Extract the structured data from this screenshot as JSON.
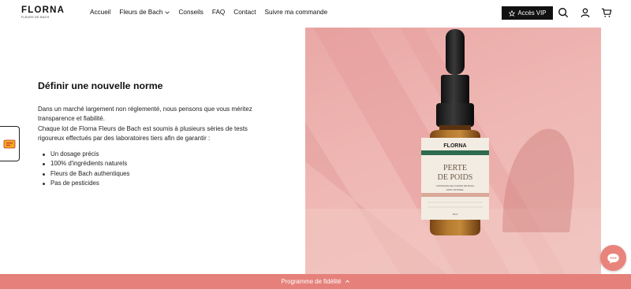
{
  "header": {
    "logo": {
      "name": "FLORNA",
      "tagline": "FLEURS DE BACH"
    },
    "nav": [
      {
        "label": "Accueil"
      },
      {
        "label": "Fleurs de Bach",
        "has_dropdown": true
      },
      {
        "label": "Conseils"
      },
      {
        "label": "FAQ"
      },
      {
        "label": "Contact"
      },
      {
        "label": "Suivre ma commande"
      }
    ],
    "vip_button": "Accès VIP",
    "icons": [
      "search-icon",
      "account-icon",
      "cart-icon"
    ]
  },
  "main": {
    "title": "Définir une nouvelle norme",
    "paragraph1": "Dans un marché largement non réglementé, nous pensons que vous méritez transparence et fiabilité.",
    "paragraph2": "Chaque lot de Florna Fleurs de Bach est soumis à plusieurs séries de tests rigoureux effectués par des laboratoires tiers afin de garantir :",
    "bullets": [
      "Un dosage précis",
      "100% d'ingrédients naturels",
      "Fleurs de Bach authentiques",
      "Pas de pesticides"
    ]
  },
  "product_image": {
    "brand": "FLORNA",
    "brand_sub": "FLEURS DE BACH",
    "product_line1": "PERTE",
    "product_line2": "DE POIDS",
    "subtitle1": "COMPLEXE DE FLEURS DE BACH",
    "subtitle2": "100% NATUREL",
    "volume": "30ml",
    "colors": {
      "background": "#efb7b3",
      "label_green": "#2f6b4f",
      "label_bg": "#f3ece2",
      "amber": "#a86a2a"
    }
  },
  "loyalty_bar": {
    "label": "Programme de fidélité",
    "color": "#e5817a"
  },
  "chat": {
    "icon": "chat-icon",
    "color": "#e8847c"
  },
  "side_tab": {
    "icon": "ticket-icon"
  }
}
